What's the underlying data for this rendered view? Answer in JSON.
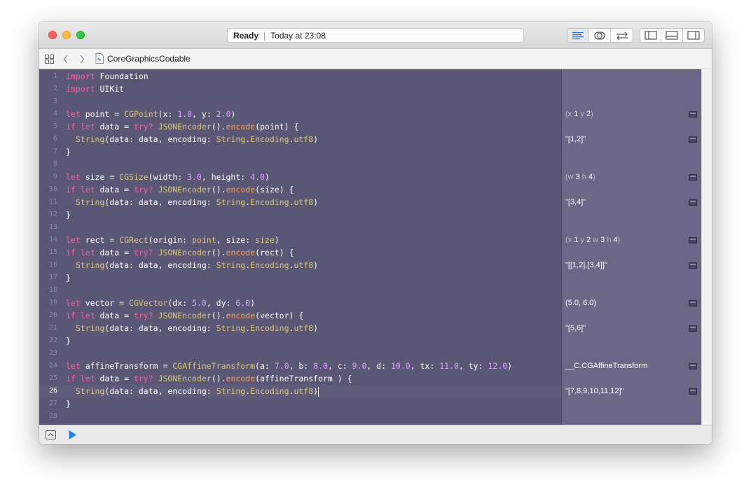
{
  "window": {
    "status": {
      "state": "Ready",
      "time": "Today at 23:08"
    }
  },
  "toolbar": {
    "editor_modes": [
      "standard-editor-icon",
      "assistant-editor-icon",
      "version-editor-icon"
    ],
    "panels": [
      "navigator-panel-icon",
      "debug-panel-icon",
      "utilities-panel-icon"
    ]
  },
  "navbar": {
    "file_name": "CoreGraphicsCodable"
  },
  "editor": {
    "current_line": 26,
    "lines": [
      {
        "n": "1",
        "t": [
          [
            "kw",
            "import "
          ],
          [
            "id",
            "Foundation"
          ]
        ]
      },
      {
        "n": "2",
        "t": [
          [
            "kw",
            "import "
          ],
          [
            "id",
            "UIKit"
          ]
        ]
      },
      {
        "n": "3",
        "t": []
      },
      {
        "n": "4",
        "t": [
          [
            "kw",
            "let "
          ],
          [
            "id",
            "point = "
          ],
          [
            "ty",
            "CGPoint"
          ],
          [
            "id",
            "(x: "
          ],
          [
            "nm",
            "1.0"
          ],
          [
            "id",
            ", y: "
          ],
          [
            "nm",
            "2.0"
          ],
          [
            "id",
            ")"
          ]
        ]
      },
      {
        "n": "5",
        "t": [
          [
            "kw",
            "if let "
          ],
          [
            "id",
            "data = "
          ],
          [
            "kw",
            "try? "
          ],
          [
            "ty",
            "JSONEncoder"
          ],
          [
            "id",
            "()."
          ],
          [
            "fn",
            "encode"
          ],
          [
            "id",
            "(point) {"
          ]
        ]
      },
      {
        "n": "6",
        "t": [
          [
            "id",
            "  "
          ],
          [
            "ty",
            "String"
          ],
          [
            "id",
            "(data: data, encoding: "
          ],
          [
            "ty",
            "String"
          ],
          [
            "id",
            "."
          ],
          [
            "ty",
            "Encoding"
          ],
          [
            "id",
            "."
          ],
          [
            "ty",
            "utf8"
          ],
          [
            "id",
            ")"
          ]
        ]
      },
      {
        "n": "7",
        "t": [
          [
            "id",
            "}"
          ]
        ]
      },
      {
        "n": "8",
        "t": []
      },
      {
        "n": "9",
        "t": [
          [
            "kw",
            "let "
          ],
          [
            "id",
            "size = "
          ],
          [
            "ty",
            "CGSize"
          ],
          [
            "id",
            "(width: "
          ],
          [
            "nm",
            "3.0"
          ],
          [
            "id",
            ", height: "
          ],
          [
            "nm",
            "4.0"
          ],
          [
            "id",
            ")"
          ]
        ]
      },
      {
        "n": "10",
        "t": [
          [
            "kw",
            "if let "
          ],
          [
            "id",
            "data = "
          ],
          [
            "kw",
            "try? "
          ],
          [
            "ty",
            "JSONEncoder"
          ],
          [
            "id",
            "()."
          ],
          [
            "fn",
            "encode"
          ],
          [
            "id",
            "(size) {"
          ]
        ]
      },
      {
        "n": "11",
        "t": [
          [
            "id",
            "  "
          ],
          [
            "ty",
            "String"
          ],
          [
            "id",
            "(data: data, encoding: "
          ],
          [
            "ty",
            "String"
          ],
          [
            "id",
            "."
          ],
          [
            "ty",
            "Encoding"
          ],
          [
            "id",
            "."
          ],
          [
            "ty",
            "utf8"
          ],
          [
            "id",
            ")"
          ]
        ]
      },
      {
        "n": "12",
        "t": [
          [
            "id",
            "}"
          ]
        ]
      },
      {
        "n": "13",
        "t": []
      },
      {
        "n": "14",
        "t": [
          [
            "kw",
            "let "
          ],
          [
            "id",
            "rect = "
          ],
          [
            "ty",
            "CGRect"
          ],
          [
            "id",
            "(origin: "
          ],
          [
            "ty",
            "point"
          ],
          [
            "id",
            ", size: "
          ],
          [
            "ty",
            "size"
          ],
          [
            "id",
            ")"
          ]
        ]
      },
      {
        "n": "15",
        "t": [
          [
            "kw",
            "if let "
          ],
          [
            "id",
            "data = "
          ],
          [
            "kw",
            "try? "
          ],
          [
            "ty",
            "JSONEncoder"
          ],
          [
            "id",
            "()."
          ],
          [
            "fn",
            "encode"
          ],
          [
            "id",
            "(rect) {"
          ]
        ]
      },
      {
        "n": "16",
        "t": [
          [
            "id",
            "  "
          ],
          [
            "ty",
            "String"
          ],
          [
            "id",
            "(data: data, encoding: "
          ],
          [
            "ty",
            "String"
          ],
          [
            "id",
            "."
          ],
          [
            "ty",
            "Encoding"
          ],
          [
            "id",
            "."
          ],
          [
            "ty",
            "utf8"
          ],
          [
            "id",
            ")"
          ]
        ]
      },
      {
        "n": "17",
        "t": [
          [
            "id",
            "}"
          ]
        ]
      },
      {
        "n": "18",
        "t": []
      },
      {
        "n": "19",
        "t": [
          [
            "kw",
            "let "
          ],
          [
            "id",
            "vector = "
          ],
          [
            "ty",
            "CGVector"
          ],
          [
            "id",
            "(dx: "
          ],
          [
            "nm",
            "5.0"
          ],
          [
            "id",
            ", dy: "
          ],
          [
            "nm",
            "6.0"
          ],
          [
            "id",
            ")"
          ]
        ]
      },
      {
        "n": "20",
        "t": [
          [
            "kw",
            "if let "
          ],
          [
            "id",
            "data = "
          ],
          [
            "kw",
            "try? "
          ],
          [
            "ty",
            "JSONEncoder"
          ],
          [
            "id",
            "()."
          ],
          [
            "fn",
            "encode"
          ],
          [
            "id",
            "(vector) {"
          ]
        ]
      },
      {
        "n": "21",
        "t": [
          [
            "id",
            "  "
          ],
          [
            "ty",
            "String"
          ],
          [
            "id",
            "(data: data, encoding: "
          ],
          [
            "ty",
            "String"
          ],
          [
            "id",
            "."
          ],
          [
            "ty",
            "Encoding"
          ],
          [
            "id",
            "."
          ],
          [
            "ty",
            "utf8"
          ],
          [
            "id",
            ")"
          ]
        ]
      },
      {
        "n": "22",
        "t": [
          [
            "id",
            "}"
          ]
        ]
      },
      {
        "n": "23",
        "t": []
      },
      {
        "n": "24",
        "t": [
          [
            "kw",
            "let "
          ],
          [
            "id",
            "affineTransform = "
          ],
          [
            "ty",
            "CGAffineTransform"
          ],
          [
            "id",
            "(a: "
          ],
          [
            "nm",
            "7.0"
          ],
          [
            "id",
            ", b: "
          ],
          [
            "nm",
            "8.0"
          ],
          [
            "id",
            ", c: "
          ],
          [
            "nm",
            "9.0"
          ],
          [
            "id",
            ", d: "
          ],
          [
            "nm",
            "10.0"
          ],
          [
            "id",
            ", tx: "
          ],
          [
            "nm",
            "11.0"
          ],
          [
            "id",
            ", ty: "
          ],
          [
            "nm",
            "12.0"
          ],
          [
            "id",
            ")"
          ]
        ]
      },
      {
        "n": "25",
        "t": [
          [
            "kw",
            "if let "
          ],
          [
            "id",
            "data = "
          ],
          [
            "kw",
            "try? "
          ],
          [
            "ty",
            "JSONEncoder"
          ],
          [
            "id",
            "()."
          ],
          [
            "fn",
            "encode"
          ],
          [
            "id",
            "(affineTransform ) {"
          ]
        ]
      },
      {
        "n": "26",
        "t": [
          [
            "id",
            "  "
          ],
          [
            "ty",
            "String"
          ],
          [
            "id",
            "(data: data, encoding: "
          ],
          [
            "ty",
            "String"
          ],
          [
            "id",
            "."
          ],
          [
            "ty",
            "Encoding"
          ],
          [
            "id",
            "."
          ],
          [
            "ty",
            "utf8"
          ],
          [
            "id",
            ")"
          ]
        ]
      },
      {
        "n": "27",
        "t": [
          [
            "id",
            "}"
          ]
        ]
      },
      {
        "n": "28",
        "t": []
      }
    ]
  },
  "results": [
    {
      "line": 4,
      "parts": [
        [
          "muted",
          "(x "
        ],
        [
          "num",
          "1"
        ],
        [
          "muted",
          " y "
        ],
        [
          "num",
          "2"
        ],
        [
          "muted",
          ")"
        ]
      ]
    },
    {
      "line": 6,
      "parts": [
        [
          "num",
          "\"[1,2]\""
        ]
      ]
    },
    {
      "line": 9,
      "parts": [
        [
          "muted",
          "(w "
        ],
        [
          "num",
          "3"
        ],
        [
          "muted",
          " h "
        ],
        [
          "num",
          "4"
        ],
        [
          "muted",
          ")"
        ]
      ]
    },
    {
      "line": 11,
      "parts": [
        [
          "num",
          "\"[3,4]\""
        ]
      ]
    },
    {
      "line": 14,
      "parts": [
        [
          "muted",
          "(x "
        ],
        [
          "num",
          "1"
        ],
        [
          "muted",
          " y "
        ],
        [
          "num",
          "2"
        ],
        [
          "muted",
          " w "
        ],
        [
          "num",
          "3"
        ],
        [
          "muted",
          " h "
        ],
        [
          "num",
          "4"
        ],
        [
          "muted",
          ")"
        ]
      ]
    },
    {
      "line": 16,
      "parts": [
        [
          "num",
          "\"[[1,2],[3,4]]\""
        ]
      ]
    },
    {
      "line": 19,
      "parts": [
        [
          "num",
          "(5.0, 6.0)"
        ]
      ]
    },
    {
      "line": 21,
      "parts": [
        [
          "num",
          "\"[5,6]\""
        ]
      ]
    },
    {
      "line": 24,
      "parts": [
        [
          "num",
          "__C.CGAffineTransform"
        ]
      ]
    },
    {
      "line": 26,
      "parts": [
        [
          "num",
          "\"[7,8,9,10,11,12]\""
        ]
      ]
    }
  ]
}
